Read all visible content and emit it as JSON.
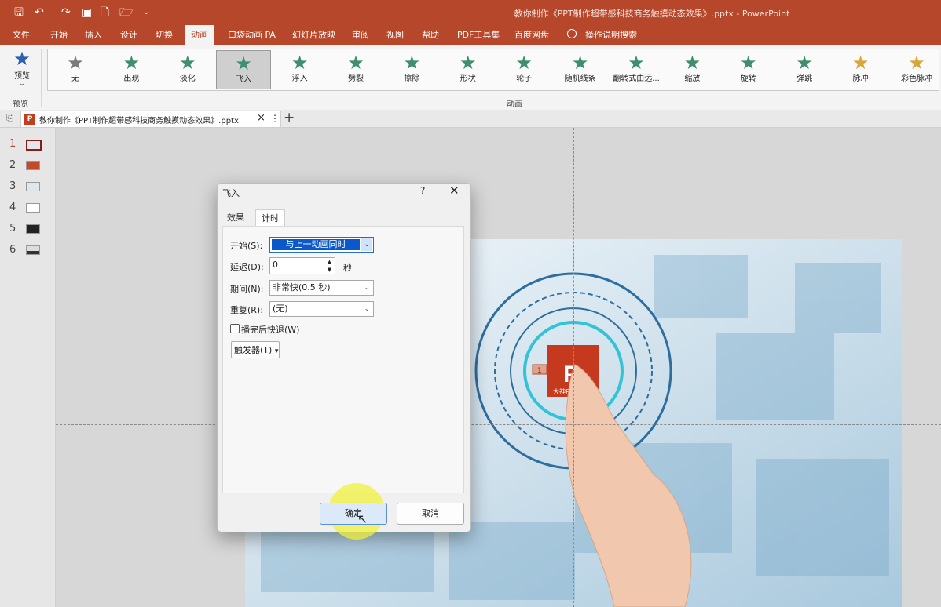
{
  "window": {
    "title": "教你制作《PPT制作超带感科技商务触摸动态效果》.pptx  -  PowerPoint"
  },
  "ribbon": {
    "tabs": [
      "文件",
      "开始",
      "插入",
      "设计",
      "切换",
      "动画",
      "口袋动画 PA",
      "幻灯片放映",
      "审阅",
      "视图",
      "帮助",
      "PDF工具集",
      "百度网盘",
      "操作说明搜索"
    ],
    "active_tab": "动画",
    "preview_label": "预览",
    "preview_group": "预览",
    "animation_group": "动画",
    "animations": [
      "无",
      "出现",
      "淡化",
      "飞入",
      "浮入",
      "劈裂",
      "擦除",
      "形状",
      "轮子",
      "随机线条",
      "翻转式由远...",
      "缩放",
      "旋转",
      "弹跳",
      "脉冲",
      "彩色脉冲"
    ],
    "selected_animation": "飞入",
    "colors": {
      "accent": "#b7472a",
      "star_green": "#3f8f6e",
      "star_gray": "#7a7a7a",
      "star_gold": "#d9a63a"
    }
  },
  "doc_tab": {
    "label": "教你制作《PPT制作超带感科技商务触摸动态效果》.pptx",
    "close": "×",
    "menu": "⋮",
    "add": "+"
  },
  "thumbnails": [
    "1",
    "2",
    "3",
    "4",
    "5",
    "6"
  ],
  "slide": {
    "logo_text": "大神PPT",
    "logo_letter": "P",
    "anim_marker": "1"
  },
  "dialog": {
    "title": "飞入",
    "help": "?",
    "close": "✕",
    "tabs": [
      "效果",
      "计时"
    ],
    "active_tab": "计时",
    "start_label": "开始(S):",
    "start_value": "与上一动画同时",
    "delay_label": "延迟(D):",
    "delay_value": "0",
    "delay_unit": "秒",
    "duration_label": "期间(N):",
    "duration_value": "非常快(0.5 秒)",
    "repeat_label": "重复(R):",
    "repeat_value": "(无)",
    "rewind_label": "播完后快退(W)",
    "rewind_checked": false,
    "trigger_label": "触发器(T)",
    "ok": "确定",
    "cancel": "取消"
  }
}
